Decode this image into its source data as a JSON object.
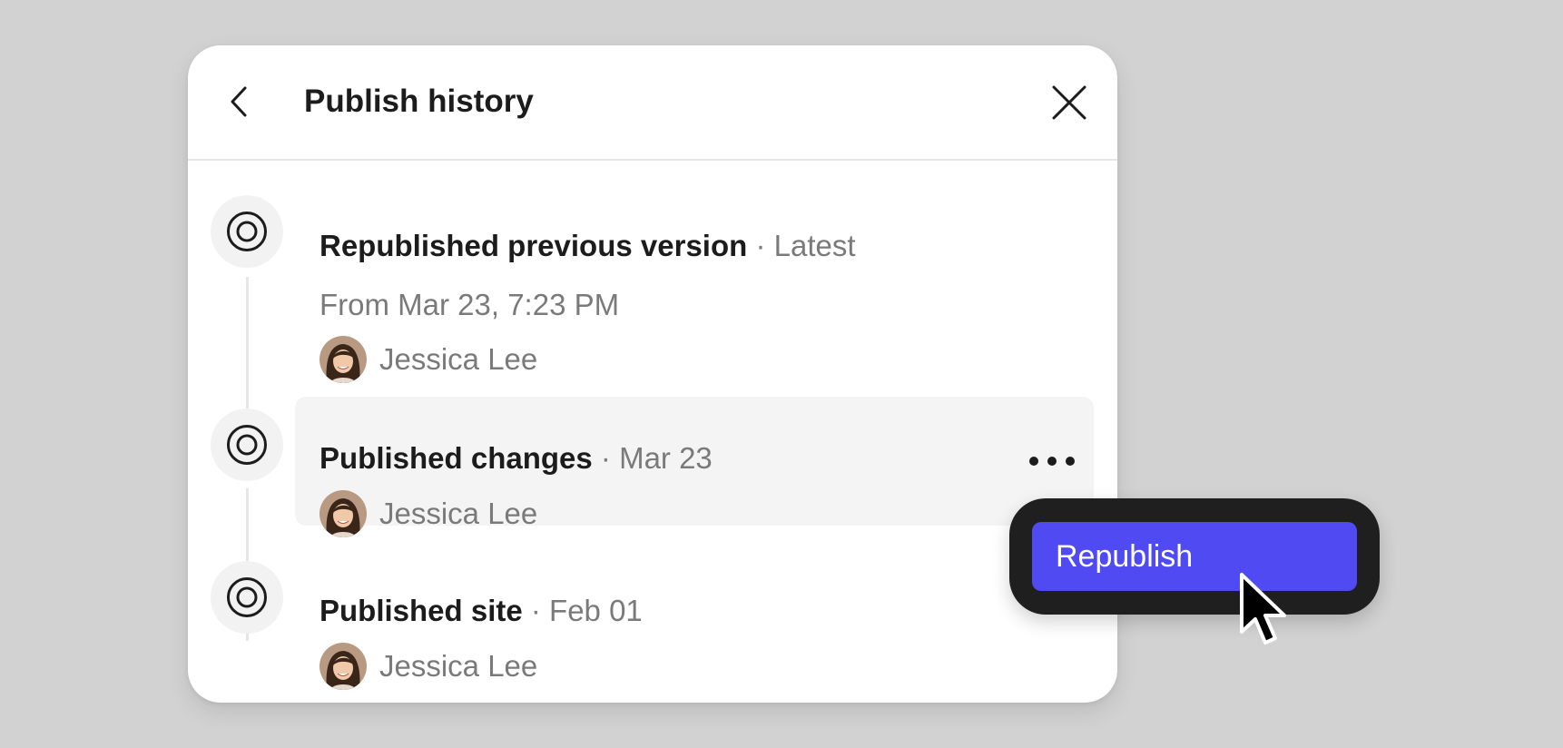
{
  "panel": {
    "title": "Publish history",
    "back_icon": "chevron-left-icon",
    "close_icon": "close-icon"
  },
  "entries": [
    {
      "action": "Republished previous version",
      "meta": "· Latest",
      "subtitle": "From Mar 23, 7:23 PM",
      "author": "Jessica Lee",
      "icon": "target-icon"
    },
    {
      "action": "Published changes",
      "meta": "· Mar 23",
      "author": "Jessica Lee",
      "icon": "target-icon",
      "hovered": true
    },
    {
      "action": "Published site",
      "meta": "· Feb 01",
      "author": "Jessica Lee",
      "icon": "target-icon"
    }
  ],
  "menu": {
    "items": [
      {
        "label": "Republish"
      }
    ]
  },
  "colors": {
    "background": "#d2d2d2",
    "accent": "#4f4af2",
    "menu_bg": "#1f1f1f",
    "text_primary": "#1c1c1c",
    "text_secondary": "#7a7a7a"
  }
}
